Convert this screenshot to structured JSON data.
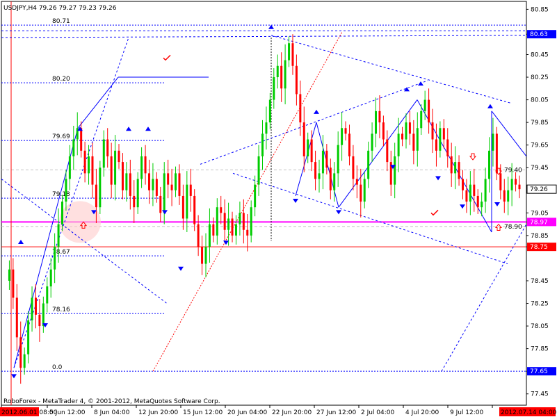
{
  "chart_data": {
    "type": "candlestick",
    "title": "USDJPY,H4  79.26 79.27 79.23 79.26",
    "footer": "RoboForex - MetaTrader 4, © 2001-2012, MetaQuotes Software Corp.",
    "ylim": [
      77.35,
      80.92
    ],
    "y_ticks": [
      "80.85",
      "80.63",
      "80.45",
      "80.25",
      "80.05",
      "79.85",
      "79.65",
      "79.45",
      "79.26",
      "79.05",
      "78.97",
      "78.85",
      "78.75",
      "78.45",
      "78.25",
      "78.05",
      "77.85",
      "77.65",
      "77.45"
    ],
    "x_ticks": [
      "2012.06.01 08:00",
      "5 Jun 12:00",
      "8 Jun 04:00",
      "12 Jun 20:00",
      "15 Jun 12:00",
      "20 Jun 04:00",
      "22 Jun 20:00",
      "27 Jun 12:00",
      "2 Jul 04:00",
      "4 Jul 20:00",
      "9 Jul 12:00",
      "2012.07.14 04:00"
    ],
    "current_price": "79.26",
    "price_markers": [
      {
        "label": "80.63",
        "value": 80.63,
        "color": "#0000ff"
      },
      {
        "label": "79.26",
        "value": 79.26,
        "color": "#000000"
      },
      {
        "label": "78.97",
        "value": 78.97,
        "color": "#ff00ff"
      },
      {
        "label": "78.75",
        "value": 78.75,
        "color": "#ff0000"
      },
      {
        "label": "77.65",
        "value": 77.65,
        "color": "#0000ff"
      }
    ],
    "fibonacci_levels": [
      {
        "label": "80.71",
        "value": 80.71
      },
      {
        "label": "80.20",
        "value": 80.2
      },
      {
        "label": "79.69",
        "value": 79.69
      },
      {
        "label": "79.18",
        "value": 79.18
      },
      {
        "label": "78.67",
        "value": 78.67
      },
      {
        "label": "78.16",
        "value": 78.16
      },
      {
        "label": "0.0",
        "value": 77.65
      }
    ],
    "horizontal_levels": [
      {
        "value": 79.43,
        "label": "79.40",
        "color": "#c0c0c0",
        "style": "dash"
      },
      {
        "value": 78.93,
        "label": "78.90",
        "color": "#c0c0c0",
        "style": "dash"
      }
    ],
    "price_series": [
      [
        0,
        78.45
      ],
      [
        1,
        78.55
      ],
      [
        2,
        78.3
      ],
      [
        3,
        77.95
      ],
      [
        4,
        77.68
      ],
      [
        5,
        77.8
      ],
      [
        6,
        78.1
      ],
      [
        7,
        78.3
      ],
      [
        8,
        78.15
      ],
      [
        9,
        78.05
      ],
      [
        10,
        78.25
      ],
      [
        11,
        78.4
      ],
      [
        12,
        78.55
      ],
      [
        13,
        78.75
      ],
      [
        14,
        78.95
      ],
      [
        15,
        79.15
      ],
      [
        16,
        79.35
      ],
      [
        17,
        79.55
      ],
      [
        18,
        79.7
      ],
      [
        19,
        79.8
      ],
      [
        20,
        79.6
      ],
      [
        21,
        79.4
      ],
      [
        22,
        79.55
      ],
      [
        23,
        79.3
      ],
      [
        24,
        79.1
      ],
      [
        25,
        79.45
      ],
      [
        26,
        79.7
      ],
      [
        27,
        79.55
      ],
      [
        28,
        79.3
      ],
      [
        29,
        79.6
      ],
      [
        30,
        79.5
      ],
      [
        31,
        79.25
      ],
      [
        32,
        79.4
      ],
      [
        33,
        79.2
      ],
      [
        34,
        79.1
      ],
      [
        35,
        79.35
      ],
      [
        36,
        79.55
      ],
      [
        37,
        79.4
      ],
      [
        38,
        79.25
      ],
      [
        39,
        79.35
      ],
      [
        40,
        79.2
      ],
      [
        41,
        79.05
      ],
      [
        42,
        79.4
      ],
      [
        43,
        79.3
      ],
      [
        44,
        79.25
      ],
      [
        45,
        79.4
      ],
      [
        46,
        79.2
      ],
      [
        47,
        79.0
      ],
      [
        48,
        79.3
      ],
      [
        49,
        79.2
      ],
      [
        50,
        78.95
      ],
      [
        51,
        78.75
      ],
      [
        52,
        78.6
      ],
      [
        53,
        78.75
      ],
      [
        54,
        78.95
      ],
      [
        55,
        78.85
      ],
      [
        56,
        79.1
      ],
      [
        57,
        79.05
      ],
      [
        58,
        78.9
      ],
      [
        59,
        79.0
      ],
      [
        60,
        78.85
      ],
      [
        61,
        78.95
      ],
      [
        62,
        79.05
      ],
      [
        63,
        78.9
      ],
      [
        64,
        78.85
      ],
      [
        65,
        79.1
      ],
      [
        66,
        79.3
      ],
      [
        67,
        79.55
      ],
      [
        68,
        79.75
      ],
      [
        69,
        79.85
      ],
      [
        70,
        80.05
      ],
      [
        71,
        80.25
      ],
      [
        72,
        80.35
      ],
      [
        73,
        80.15
      ],
      [
        74,
        80.4
      ],
      [
        75,
        80.55
      ],
      [
        76,
        80.35
      ],
      [
        77,
        80.1
      ],
      [
        78,
        79.85
      ],
      [
        79,
        79.55
      ],
      [
        80,
        79.7
      ],
      [
        81,
        79.5
      ],
      [
        82,
        79.35
      ],
      [
        83,
        79.4
      ],
      [
        84,
        79.6
      ],
      [
        85,
        79.45
      ],
      [
        86,
        79.25
      ],
      [
        87,
        79.4
      ],
      [
        88,
        79.65
      ],
      [
        89,
        79.8
      ],
      [
        90,
        79.75
      ],
      [
        91,
        79.55
      ],
      [
        92,
        79.35
      ],
      [
        93,
        79.3
      ],
      [
        94,
        79.15
      ],
      [
        95,
        79.35
      ],
      [
        96,
        79.6
      ],
      [
        97,
        79.75
      ],
      [
        98,
        79.95
      ],
      [
        99,
        79.85
      ],
      [
        100,
        79.7
      ],
      [
        101,
        79.5
      ],
      [
        102,
        79.3
      ],
      [
        103,
        79.55
      ],
      [
        104,
        79.75
      ],
      [
        105,
        79.7
      ],
      [
        106,
        79.85
      ],
      [
        107,
        79.75
      ],
      [
        108,
        79.6
      ],
      [
        109,
        79.8
      ],
      [
        110,
        79.95
      ],
      [
        111,
        80.05
      ],
      [
        112,
        79.85
      ],
      [
        113,
        79.7
      ],
      [
        114,
        79.6
      ],
      [
        115,
        79.8
      ],
      [
        116,
        79.7
      ],
      [
        117,
        79.55
      ],
      [
        118,
        79.4
      ],
      [
        119,
        79.5
      ],
      [
        120,
        79.35
      ],
      [
        121,
        79.25
      ],
      [
        122,
        79.15
      ],
      [
        123,
        79.3
      ],
      [
        124,
        79.2
      ],
      [
        125,
        79.1
      ],
      [
        126,
        79.15
      ],
      [
        127,
        79.35
      ],
      [
        128,
        79.6
      ],
      [
        129,
        79.75
      ],
      [
        130,
        79.4
      ],
      [
        131,
        79.25
      ],
      [
        132,
        79.15
      ],
      [
        133,
        79.25
      ],
      [
        134,
        79.35
      ],
      [
        135,
        79.3
      ],
      [
        136,
        79.26
      ]
    ]
  },
  "annotations": {
    "checkmark_color": "#ff0000",
    "arrow_color": "#0000ff",
    "trend_color": "#0000ff",
    "fib_color": "#0000ff",
    "up_arrow_color": "#ff0000"
  }
}
